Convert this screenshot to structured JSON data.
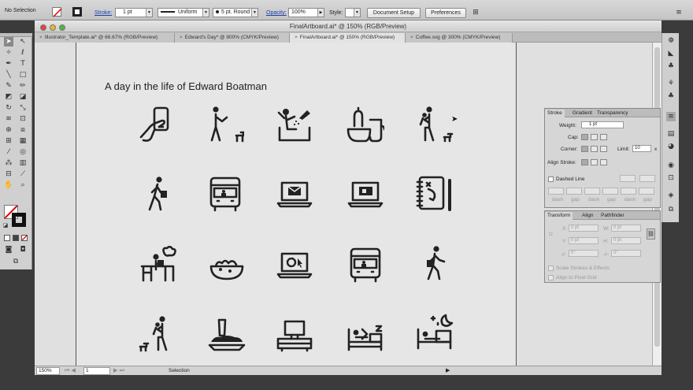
{
  "control_bar": {
    "selection_label": "No Selection",
    "stroke_label": "Stroke:",
    "stroke_weight": "1 pt",
    "profile": "Uniform",
    "brush": "5 pt. Round",
    "opacity_label": "Opacity:",
    "opacity_value": "100%",
    "style_label": "Style:",
    "document_setup": "Document Setup",
    "preferences": "Preferences"
  },
  "window": {
    "title": "FinalArtboard.ai* @ 150% (RGB/Preview)",
    "tabs": [
      {
        "label": "Illustrator_Template.ai* @ 66.67% (RGB/Preview)"
      },
      {
        "label": "Edward's Day* @ 800% (CMYK/Preview)"
      },
      {
        "label": "FinalArtboard.ai* @ 150% (RGB/Preview)"
      },
      {
        "label": "Coffee.svg @ 300% (CMYK/Preview)"
      }
    ]
  },
  "artboard": {
    "heading": "A day in the life of Edward Boatman",
    "icons": [
      "phone-in-hand-icon",
      "man-walking-dog-icon",
      "shower-icon",
      "breakfast-icon",
      "man-holding-baby-dog-icon",
      "walking-commuter-icon",
      "bus-icon",
      "email-laptop-icon",
      "chat-laptop-icon",
      "notebook-plan-icon",
      "desk-worker-icon",
      "salad-bowl-icon",
      "loading-laptop-icon",
      "bus-icon",
      "walking-commuter-icon",
      "man-holding-baby-dog-icon",
      "dinner-tray-icon",
      "tv-console-icon",
      "bedtime-reading-icon",
      "sleeping-icon"
    ]
  },
  "status_bar": {
    "zoom": "150%",
    "artboard_num": "1",
    "tool": "Selection"
  },
  "stroke_panel": {
    "tabs": [
      "Stroke",
      "Gradient",
      "Transparency"
    ],
    "weight_label": "Weight:",
    "weight_value": "1 pt",
    "cap_label": "Cap:",
    "corner_label": "Corner:",
    "limit_label": "Limit:",
    "limit_value": "10",
    "limit_unit": "x",
    "align_label": "Align Stroke:",
    "dashed_label": "Dashed Line",
    "dash_labels": [
      "dash",
      "gap",
      "dash",
      "gap",
      "dash",
      "gap"
    ]
  },
  "transform_panel": {
    "tabs": [
      "Transform",
      "Align",
      "Pathfinder"
    ],
    "x_label": "X:",
    "x_value": "0 pt",
    "w_label": "W:",
    "w_value": "0 pt",
    "y_label": "Y:",
    "y_value": "0 pt",
    "h_label": "H:",
    "h_value": "0 pt",
    "rot_label": "⊿:",
    "rot_value": "0°",
    "shear_label": "⊿:",
    "shear_value": "0°",
    "scale_strokes": "Scale Strokes & Effects",
    "align_pixel": "Align to Pixel Grid"
  }
}
